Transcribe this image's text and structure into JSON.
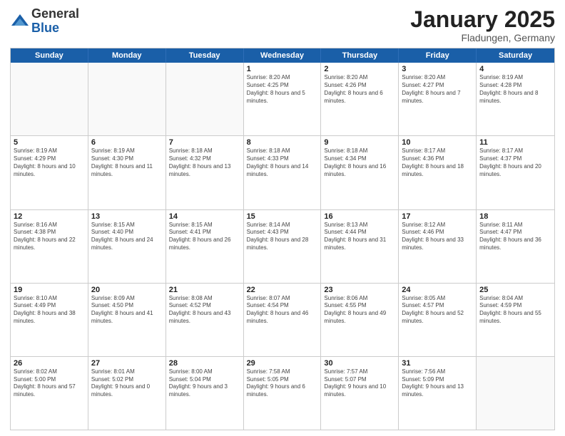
{
  "header": {
    "logo_general": "General",
    "logo_blue": "Blue",
    "month_title": "January 2025",
    "location": "Fladungen, Germany"
  },
  "days_of_week": [
    "Sunday",
    "Monday",
    "Tuesday",
    "Wednesday",
    "Thursday",
    "Friday",
    "Saturday"
  ],
  "weeks": [
    [
      {
        "day": "",
        "sunrise": "",
        "sunset": "",
        "daylight": "",
        "empty": true
      },
      {
        "day": "",
        "sunrise": "",
        "sunset": "",
        "daylight": "",
        "empty": true
      },
      {
        "day": "",
        "sunrise": "",
        "sunset": "",
        "daylight": "",
        "empty": true
      },
      {
        "day": "1",
        "sunrise": "Sunrise: 8:20 AM",
        "sunset": "Sunset: 4:25 PM",
        "daylight": "Daylight: 8 hours and 5 minutes."
      },
      {
        "day": "2",
        "sunrise": "Sunrise: 8:20 AM",
        "sunset": "Sunset: 4:26 PM",
        "daylight": "Daylight: 8 hours and 6 minutes."
      },
      {
        "day": "3",
        "sunrise": "Sunrise: 8:20 AM",
        "sunset": "Sunset: 4:27 PM",
        "daylight": "Daylight: 8 hours and 7 minutes."
      },
      {
        "day": "4",
        "sunrise": "Sunrise: 8:19 AM",
        "sunset": "Sunset: 4:28 PM",
        "daylight": "Daylight: 8 hours and 8 minutes."
      }
    ],
    [
      {
        "day": "5",
        "sunrise": "Sunrise: 8:19 AM",
        "sunset": "Sunset: 4:29 PM",
        "daylight": "Daylight: 8 hours and 10 minutes."
      },
      {
        "day": "6",
        "sunrise": "Sunrise: 8:19 AM",
        "sunset": "Sunset: 4:30 PM",
        "daylight": "Daylight: 8 hours and 11 minutes."
      },
      {
        "day": "7",
        "sunrise": "Sunrise: 8:18 AM",
        "sunset": "Sunset: 4:32 PM",
        "daylight": "Daylight: 8 hours and 13 minutes."
      },
      {
        "day": "8",
        "sunrise": "Sunrise: 8:18 AM",
        "sunset": "Sunset: 4:33 PM",
        "daylight": "Daylight: 8 hours and 14 minutes."
      },
      {
        "day": "9",
        "sunrise": "Sunrise: 8:18 AM",
        "sunset": "Sunset: 4:34 PM",
        "daylight": "Daylight: 8 hours and 16 minutes."
      },
      {
        "day": "10",
        "sunrise": "Sunrise: 8:17 AM",
        "sunset": "Sunset: 4:36 PM",
        "daylight": "Daylight: 8 hours and 18 minutes."
      },
      {
        "day": "11",
        "sunrise": "Sunrise: 8:17 AM",
        "sunset": "Sunset: 4:37 PM",
        "daylight": "Daylight: 8 hours and 20 minutes."
      }
    ],
    [
      {
        "day": "12",
        "sunrise": "Sunrise: 8:16 AM",
        "sunset": "Sunset: 4:38 PM",
        "daylight": "Daylight: 8 hours and 22 minutes."
      },
      {
        "day": "13",
        "sunrise": "Sunrise: 8:15 AM",
        "sunset": "Sunset: 4:40 PM",
        "daylight": "Daylight: 8 hours and 24 minutes."
      },
      {
        "day": "14",
        "sunrise": "Sunrise: 8:15 AM",
        "sunset": "Sunset: 4:41 PM",
        "daylight": "Daylight: 8 hours and 26 minutes."
      },
      {
        "day": "15",
        "sunrise": "Sunrise: 8:14 AM",
        "sunset": "Sunset: 4:43 PM",
        "daylight": "Daylight: 8 hours and 28 minutes."
      },
      {
        "day": "16",
        "sunrise": "Sunrise: 8:13 AM",
        "sunset": "Sunset: 4:44 PM",
        "daylight": "Daylight: 8 hours and 31 minutes."
      },
      {
        "day": "17",
        "sunrise": "Sunrise: 8:12 AM",
        "sunset": "Sunset: 4:46 PM",
        "daylight": "Daylight: 8 hours and 33 minutes."
      },
      {
        "day": "18",
        "sunrise": "Sunrise: 8:11 AM",
        "sunset": "Sunset: 4:47 PM",
        "daylight": "Daylight: 8 hours and 36 minutes."
      }
    ],
    [
      {
        "day": "19",
        "sunrise": "Sunrise: 8:10 AM",
        "sunset": "Sunset: 4:49 PM",
        "daylight": "Daylight: 8 hours and 38 minutes."
      },
      {
        "day": "20",
        "sunrise": "Sunrise: 8:09 AM",
        "sunset": "Sunset: 4:50 PM",
        "daylight": "Daylight: 8 hours and 41 minutes."
      },
      {
        "day": "21",
        "sunrise": "Sunrise: 8:08 AM",
        "sunset": "Sunset: 4:52 PM",
        "daylight": "Daylight: 8 hours and 43 minutes."
      },
      {
        "day": "22",
        "sunrise": "Sunrise: 8:07 AM",
        "sunset": "Sunset: 4:54 PM",
        "daylight": "Daylight: 8 hours and 46 minutes."
      },
      {
        "day": "23",
        "sunrise": "Sunrise: 8:06 AM",
        "sunset": "Sunset: 4:55 PM",
        "daylight": "Daylight: 8 hours and 49 minutes."
      },
      {
        "day": "24",
        "sunrise": "Sunrise: 8:05 AM",
        "sunset": "Sunset: 4:57 PM",
        "daylight": "Daylight: 8 hours and 52 minutes."
      },
      {
        "day": "25",
        "sunrise": "Sunrise: 8:04 AM",
        "sunset": "Sunset: 4:59 PM",
        "daylight": "Daylight: 8 hours and 55 minutes."
      }
    ],
    [
      {
        "day": "26",
        "sunrise": "Sunrise: 8:02 AM",
        "sunset": "Sunset: 5:00 PM",
        "daylight": "Daylight: 8 hours and 57 minutes."
      },
      {
        "day": "27",
        "sunrise": "Sunrise: 8:01 AM",
        "sunset": "Sunset: 5:02 PM",
        "daylight": "Daylight: 9 hours and 0 minutes."
      },
      {
        "day": "28",
        "sunrise": "Sunrise: 8:00 AM",
        "sunset": "Sunset: 5:04 PM",
        "daylight": "Daylight: 9 hours and 3 minutes."
      },
      {
        "day": "29",
        "sunrise": "Sunrise: 7:58 AM",
        "sunset": "Sunset: 5:05 PM",
        "daylight": "Daylight: 9 hours and 6 minutes."
      },
      {
        "day": "30",
        "sunrise": "Sunrise: 7:57 AM",
        "sunset": "Sunset: 5:07 PM",
        "daylight": "Daylight: 9 hours and 10 minutes."
      },
      {
        "day": "31",
        "sunrise": "Sunrise: 7:56 AM",
        "sunset": "Sunset: 5:09 PM",
        "daylight": "Daylight: 9 hours and 13 minutes."
      },
      {
        "day": "",
        "sunrise": "",
        "sunset": "",
        "daylight": "",
        "empty": true
      }
    ]
  ]
}
